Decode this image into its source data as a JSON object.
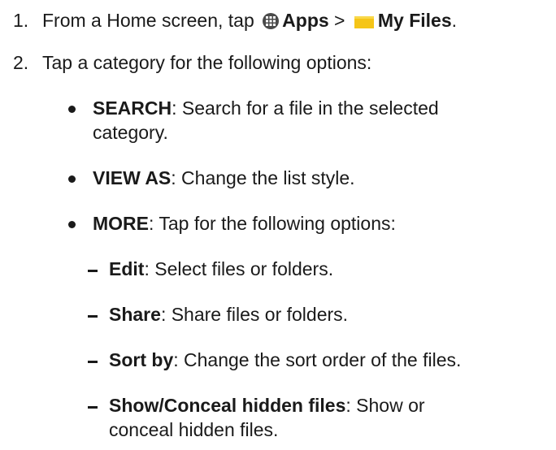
{
  "steps": [
    {
      "num": "1.",
      "pre": "From a Home screen, tap",
      "apps_label": "Apps",
      "sep": ">",
      "myfiles_label": "My Files",
      "end": "."
    },
    {
      "num": "2.",
      "text": "Tap a category for the following options:"
    }
  ],
  "bullets": [
    {
      "label": "SEARCH",
      "text_line1": ": Search for a file in the selected",
      "text_line2": "category."
    },
    {
      "label": "VIEW AS",
      "text_line1": ": Change the list style."
    },
    {
      "label": "MORE",
      "text_line1": ": Tap for the following options:"
    }
  ],
  "sub_items": [
    {
      "label": "Edit",
      "text_line1": ": Select files or folders."
    },
    {
      "label": "Share",
      "text_line1": ": Share files or folders."
    },
    {
      "label": "Sort by",
      "text_line1": ": Change the sort order of the files."
    },
    {
      "label": "Show/Conceal hidden files",
      "text_line1": ": Show or",
      "text_line2": "conceal hidden files."
    }
  ],
  "icons": {
    "apps": "apps-grid-icon",
    "myfiles": "folder-icon",
    "folder_color": "#f5c518",
    "apps_color": "#4a4a4a"
  }
}
